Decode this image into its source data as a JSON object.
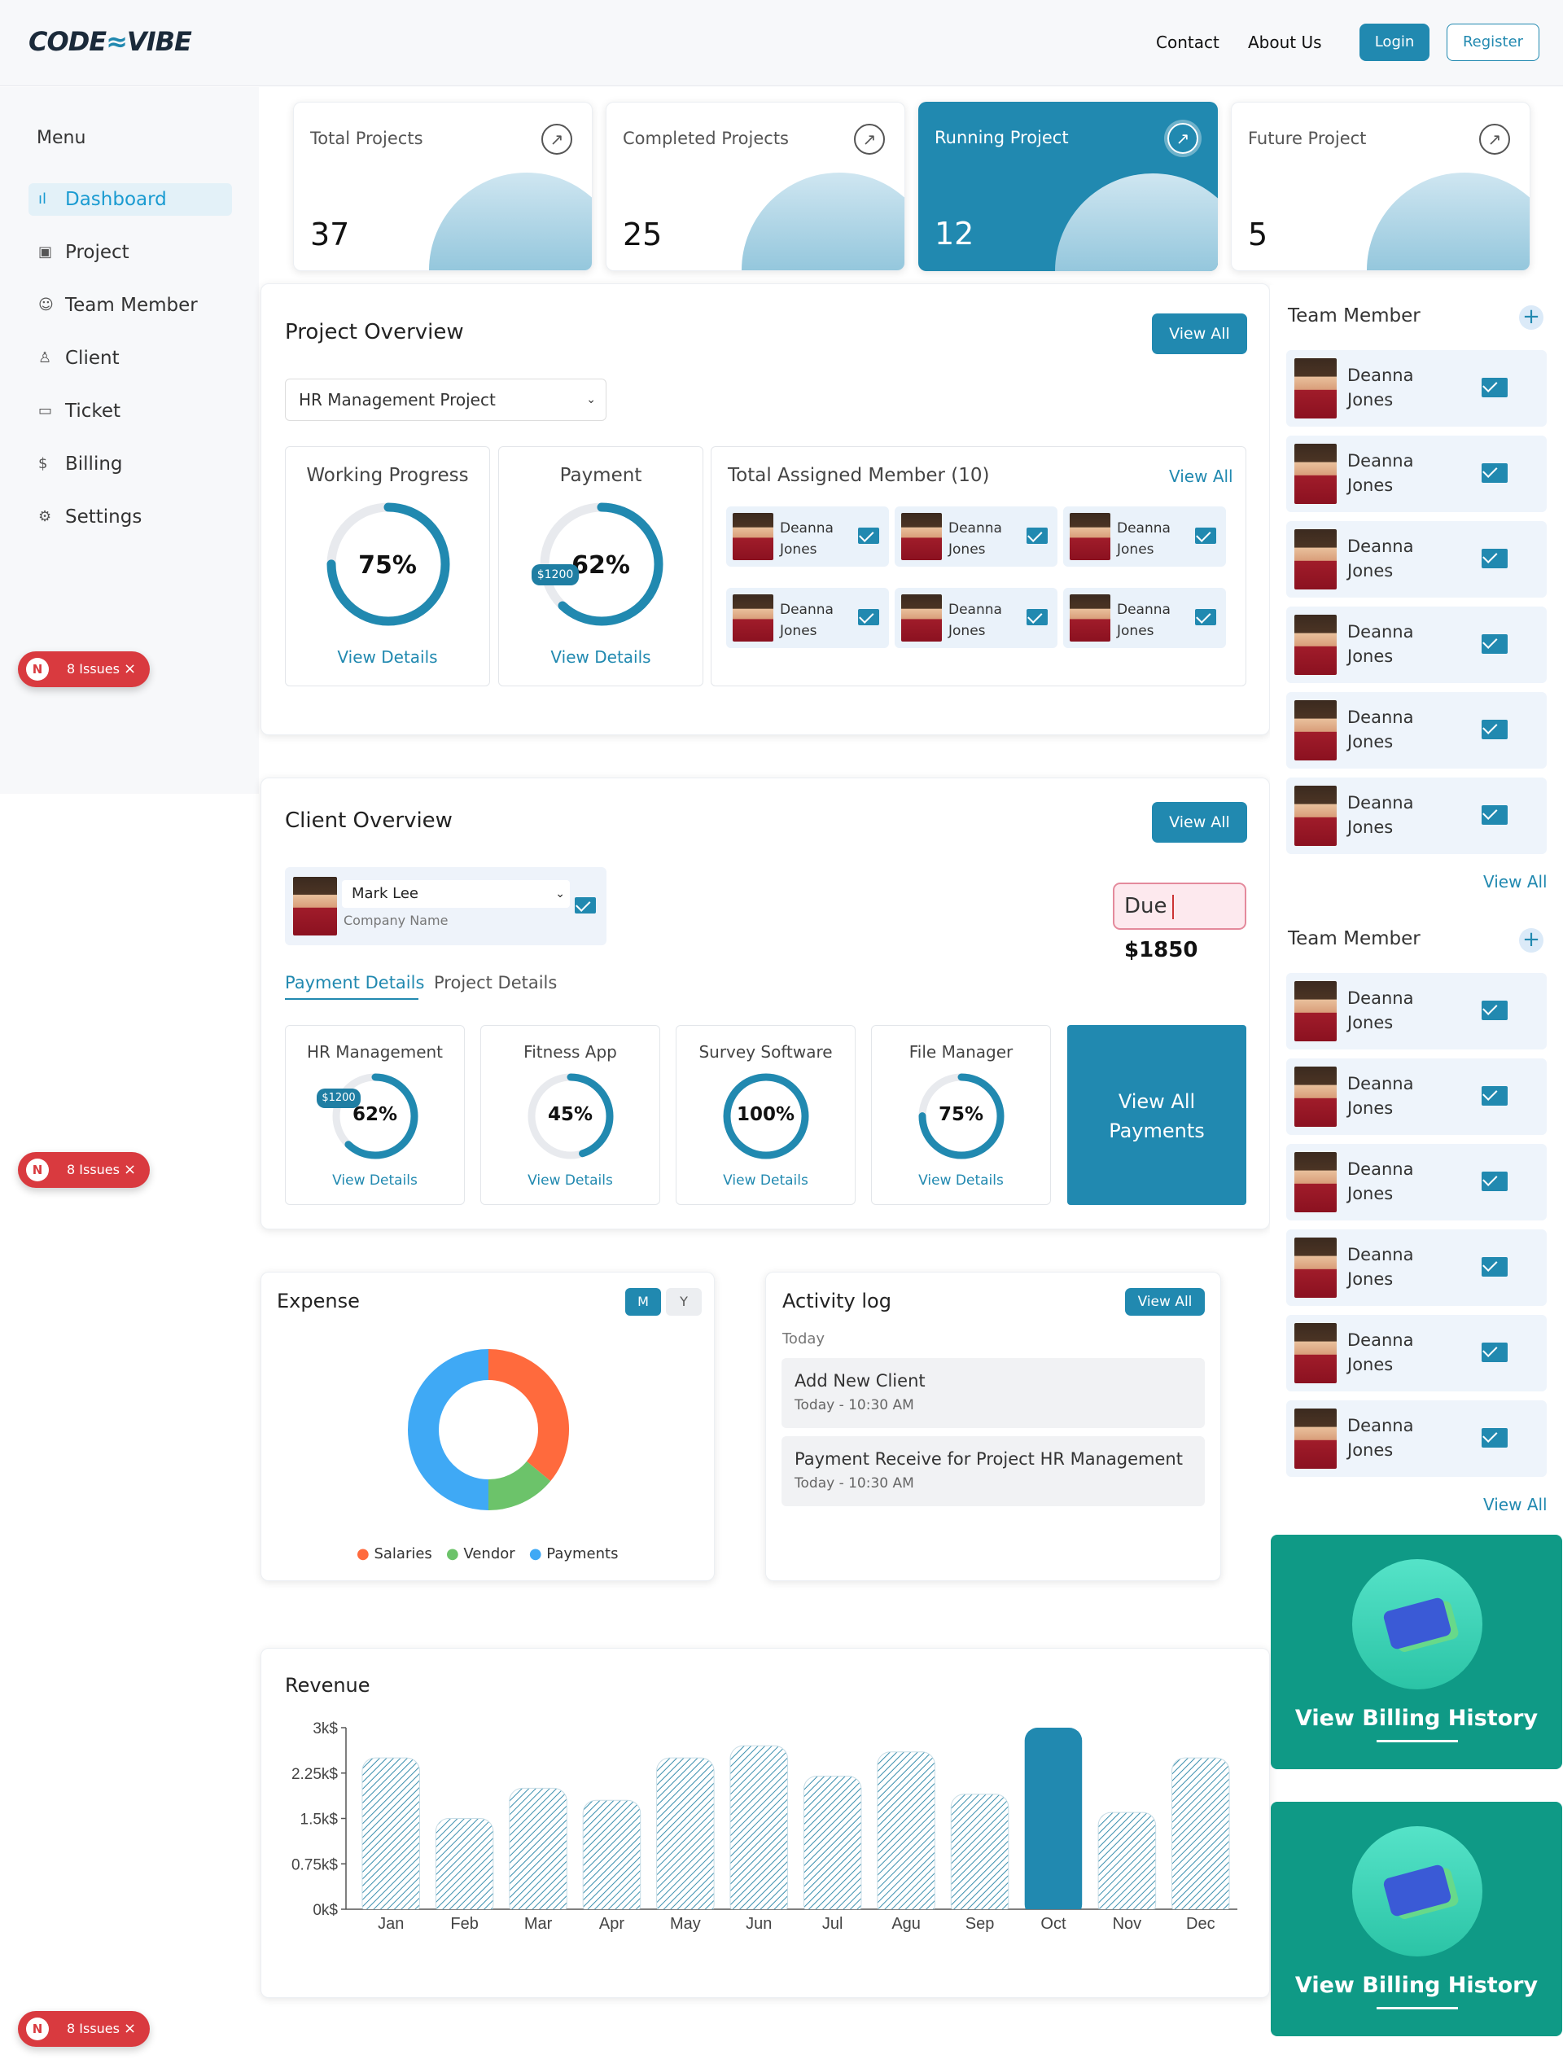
{
  "header": {
    "logo_left": "CODE",
    "logo_mark": "≈",
    "logo_right": "VIBE",
    "nav": [
      "Contact",
      "About Us"
    ],
    "login": "Login",
    "register": "Register"
  },
  "sidebar": {
    "title": "Menu",
    "items": [
      {
        "label": "Dashboard",
        "icon": "bar-chart-icon",
        "active": true
      },
      {
        "label": "Project",
        "icon": "briefcase-icon"
      },
      {
        "label": "Team Member",
        "icon": "users-icon"
      },
      {
        "label": "Client",
        "icon": "user-icon"
      },
      {
        "label": "Ticket",
        "icon": "ticket-icon"
      },
      {
        "label": "Billing",
        "icon": "dollar-icon"
      },
      {
        "label": "Settings",
        "icon": "gear-icon"
      }
    ]
  },
  "issues_badge": {
    "letter": "N",
    "label": "8 Issues",
    "close": "×"
  },
  "stats": [
    {
      "label": "Total Projects",
      "value": "37"
    },
    {
      "label": "Completed Projects",
      "value": "25"
    },
    {
      "label": "Running Project",
      "value": "12"
    },
    {
      "label": "Future Project",
      "value": "5"
    }
  ],
  "project_overview": {
    "title": "Project Overview",
    "view_all": "View All",
    "selected_project": "HR Management Project",
    "working_progress": {
      "title": "Working Progress",
      "percent_label": "75%",
      "percent": 75,
      "link": "View Details"
    },
    "payment": {
      "title": "Payment",
      "percent_label": "62%",
      "percent": 62,
      "amount": "$1200",
      "link": "View Details"
    },
    "assigned": {
      "title": "Total Assigned Member (10)",
      "link": "View All",
      "members": [
        {
          "first": "Deanna",
          "last": "Jones"
        },
        {
          "first": "Deanna",
          "last": "Jones"
        },
        {
          "first": "Deanna",
          "last": "Jones"
        },
        {
          "first": "Deanna",
          "last": "Jones"
        },
        {
          "first": "Deanna",
          "last": "Jones"
        },
        {
          "first": "Deanna",
          "last": "Jones"
        }
      ]
    }
  },
  "client_overview": {
    "title": "Client Overview",
    "view_all": "View All",
    "client_name": "Mark Lee",
    "company": "Company Name",
    "due_label": "Due",
    "due_amount": "$1850",
    "tabs": [
      "Payment Details",
      "Project Details"
    ],
    "payments": [
      {
        "title": "HR Management",
        "percent_label": "62%",
        "percent": 62,
        "amount": "$1200",
        "link": "View Details"
      },
      {
        "title": "Fitness App",
        "percent_label": "45%",
        "percent": 45,
        "link": "View Details"
      },
      {
        "title": "Survey Software",
        "percent_label": "100%",
        "percent": 100,
        "link": "View Details"
      },
      {
        "title": "File Manager",
        "percent_label": "75%",
        "percent": 75,
        "link": "View Details"
      }
    ],
    "view_all_payments_1": "View All",
    "view_all_payments_2": "Payments"
  },
  "expense": {
    "title": "Expense",
    "toggle_m": "M",
    "toggle_y": "Y",
    "legend": [
      {
        "label": "Salaries",
        "color": "#ff6a3d"
      },
      {
        "label": "Vendor",
        "color": "#6cc36a"
      },
      {
        "label": "Payments",
        "color": "#3fa9f5"
      }
    ]
  },
  "activity": {
    "title": "Activity log",
    "view_all": "View All",
    "day": "Today",
    "items": [
      {
        "title": "Add New Client",
        "time": "Today - 10:30 AM"
      },
      {
        "title": "Payment Receive for Project HR Management",
        "time": "Today - 10:30 AM"
      }
    ]
  },
  "team_panels": [
    {
      "title": "Team Member",
      "plus": "+",
      "view_all": "View All",
      "members": [
        {
          "first": "Deanna",
          "last": "Jones"
        },
        {
          "first": "Deanna",
          "last": "Jones"
        },
        {
          "first": "Deanna",
          "last": "Jones"
        },
        {
          "first": "Deanna",
          "last": "Jones"
        },
        {
          "first": "Deanna",
          "last": "Jones"
        },
        {
          "first": "Deanna",
          "last": "Jones"
        }
      ]
    },
    {
      "title": "Team Member",
      "plus": "+",
      "view_all": "View All",
      "members": [
        {
          "first": "Deanna",
          "last": "Jones"
        },
        {
          "first": "Deanna",
          "last": "Jones"
        },
        {
          "first": "Deanna",
          "last": "Jones"
        },
        {
          "first": "Deanna",
          "last": "Jones"
        },
        {
          "first": "Deanna",
          "last": "Jones"
        },
        {
          "first": "Deanna",
          "last": "Jones"
        }
      ]
    }
  ],
  "billing": {
    "label": "View Billing History"
  },
  "chart_data": [
    {
      "type": "pie",
      "title": "Expense",
      "categories": [
        "Salaries",
        "Vendor",
        "Payments"
      ],
      "values": [
        36,
        14,
        50
      ],
      "colors": [
        "#ff6a3d",
        "#6cc36a",
        "#3fa9f5"
      ]
    },
    {
      "type": "bar",
      "title": "Revenue",
      "categories": [
        "Jan",
        "Feb",
        "Mar",
        "Apr",
        "May",
        "Jun",
        "Jul",
        "Agu",
        "Sep",
        "Oct",
        "Nov",
        "Dec"
      ],
      "values": [
        2.5,
        1.5,
        2.0,
        1.8,
        2.5,
        2.7,
        2.2,
        2.6,
        1.9,
        3.0,
        1.6,
        2.5
      ],
      "highlight": "Oct",
      "ylim": [
        0,
        3
      ],
      "yticks": [
        "0k$",
        "0.75k$",
        "1.5k$",
        "2.25k$",
        "3k$"
      ],
      "bar_color": "#2189b0"
    }
  ]
}
